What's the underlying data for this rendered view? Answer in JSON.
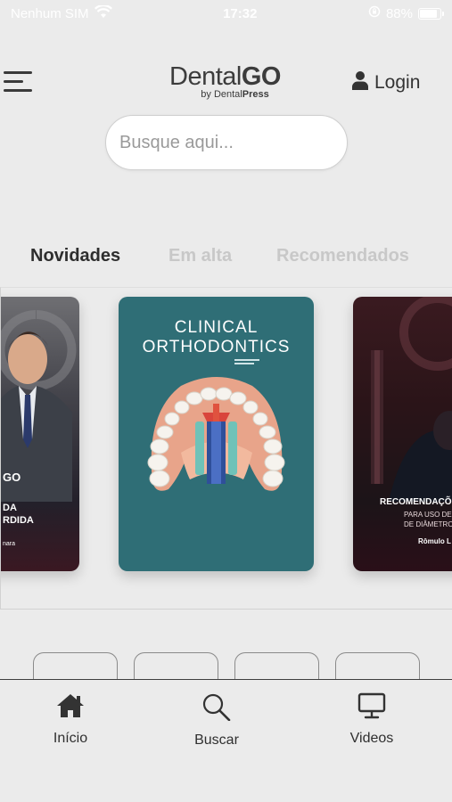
{
  "status_bar": {
    "carrier": "Nenhum SIM",
    "time": "17:32",
    "battery": "88%",
    "battery_level": 0.88
  },
  "header": {
    "logo_dental": "Dental",
    "logo_go": "GO",
    "logo_by": "by Dental",
    "logo_press": "Press",
    "login_label": "Login"
  },
  "search": {
    "placeholder": "Busque aqui..."
  },
  "tabs": [
    {
      "label": "Novidades",
      "active": true
    },
    {
      "label": "Em alta",
      "active": false
    },
    {
      "label": "Recomendados",
      "active": false
    }
  ],
  "carousel": {
    "left_card": {
      "brand": "GO",
      "line1": "DA",
      "line2": "RDIDA",
      "author": "nara"
    },
    "center_card": {
      "title_line1": "CLINICAL",
      "title_line2": "ORTHODONTICS"
    },
    "right_card": {
      "title": "RECOMENDAÇÕ",
      "line1": "PARA USO DE M",
      "line2": "DE DIÂMETRO",
      "author": "Rômulo L"
    }
  },
  "bottom_nav": [
    {
      "label": "Início",
      "icon": "home-icon"
    },
    {
      "label": "Buscar",
      "icon": "search-icon"
    },
    {
      "label": "Videos",
      "icon": "monitor-icon"
    }
  ],
  "colors": {
    "background": "#ebebeb",
    "teal_cover": "#2f6e76",
    "text_dark": "#2e2e2e",
    "tab_inactive": "#c8c8c8"
  }
}
